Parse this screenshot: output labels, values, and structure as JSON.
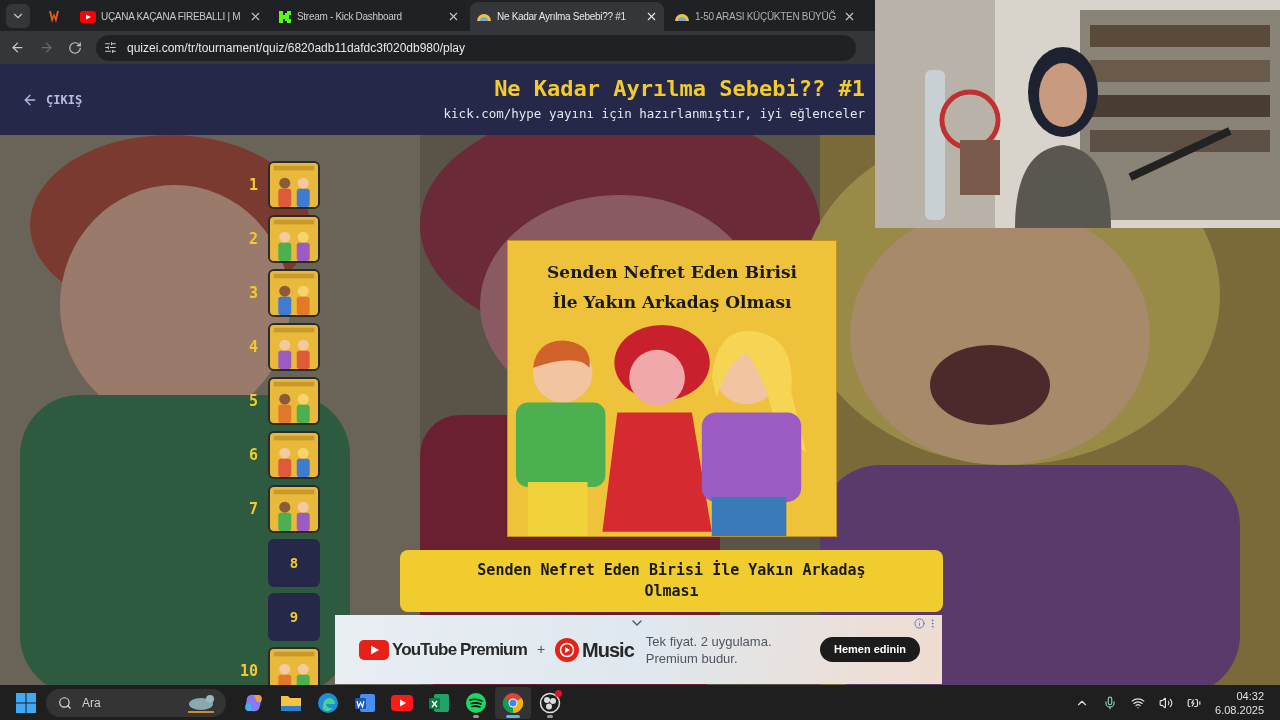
{
  "browser": {
    "tabs": [
      {
        "kind": "pinned",
        "selected": false
      },
      {
        "kind": "youtube",
        "title": "UÇANA KAÇANA FIREBALLI | M",
        "selected": false
      },
      {
        "kind": "kick",
        "title": "Stream - Kick Dashboard",
        "selected": false
      },
      {
        "kind": "quiz",
        "title": "Ne Kadar Ayrılma Sebebi?? #1",
        "selected": true
      },
      {
        "kind": "quiz",
        "title": "1-50 ARASI KÜÇÜKTEN BÜYÜĞ",
        "selected": false
      }
    ],
    "url": "quizei.com/tr/tournament/quiz/6820adb11dafdc3f020db980/play"
  },
  "header": {
    "back_label": "ÇIKIŞ",
    "title": "Ne Kadar Ayrılma Sebebi?? #1",
    "subtitle": "kick.com/hype yayını için hazırlanmıştır, iyi eğlenceler"
  },
  "rounds": [
    {
      "number": "1",
      "kind": "picture"
    },
    {
      "number": "2",
      "kind": "picture"
    },
    {
      "number": "3",
      "kind": "picture"
    },
    {
      "number": "4",
      "kind": "picture"
    },
    {
      "number": "5",
      "kind": "picture"
    },
    {
      "number": "6",
      "kind": "picture"
    },
    {
      "number": "7",
      "kind": "picture"
    },
    {
      "number": "8",
      "kind": "empty"
    },
    {
      "number": "9",
      "kind": "empty"
    },
    {
      "number": "10",
      "kind": "picture"
    }
  ],
  "question": {
    "card_title_lines": [
      "Senden Nefret Eden Birisi",
      "İle Yakın Arkadaş Olması"
    ],
    "answer": "Senden Nefret Eden Birisi İle Yakın Arkadaş Olması"
  },
  "ad": {
    "brand": "YouTube Premium",
    "plus": "+",
    "product": "Music",
    "tagline_lines": [
      "Tek fiyat. 2 uygulama.",
      "Premium budur."
    ],
    "cta": "Hemen edinin"
  },
  "taskbar": {
    "search_placeholder": "Ara",
    "apps": [
      {
        "kind": "copilot",
        "running": false,
        "selected": false,
        "notification": false
      },
      {
        "kind": "folder",
        "running": false,
        "selected": false,
        "notification": false
      },
      {
        "kind": "edge",
        "running": false,
        "selected": false,
        "notification": false
      },
      {
        "kind": "word",
        "running": false,
        "selected": false,
        "notification": false
      },
      {
        "kind": "youtube",
        "running": false,
        "selected": false,
        "notification": false
      },
      {
        "kind": "excel",
        "running": false,
        "selected": false,
        "notification": false
      },
      {
        "kind": "spotify",
        "running": true,
        "selected": false,
        "notification": false
      },
      {
        "kind": "chrome",
        "running": true,
        "selected": true,
        "notification": false
      },
      {
        "kind": "obs",
        "running": true,
        "selected": false,
        "notification": true
      }
    ],
    "time": "04:32",
    "date": "6.08.2025"
  }
}
